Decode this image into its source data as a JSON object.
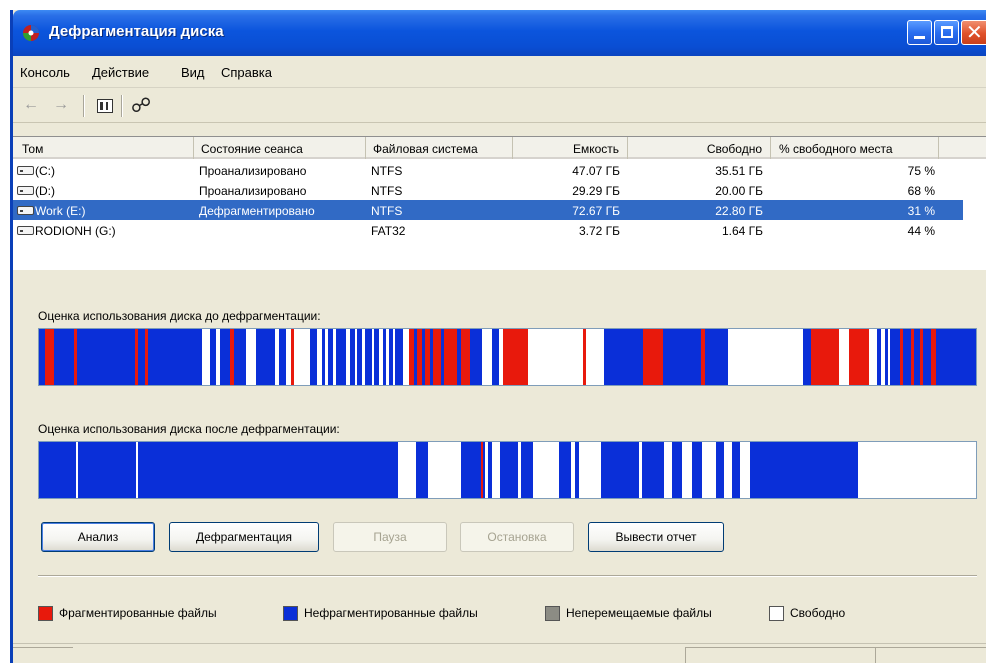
{
  "window": {
    "title": "Дефрагментация диска"
  },
  "menu": [
    "Консоль",
    "Действие",
    "Вид",
    "Справка"
  ],
  "toolbar": {
    "back_icon": "arrow-left-icon",
    "forward_icon": "arrow-right-icon",
    "view_icon": "show-hide-tree-icon",
    "help_icon": "help-icon"
  },
  "volumes": {
    "columns": [
      "Том",
      "Состояние сеанса",
      "Файловая система",
      "Емкость",
      "Свободно",
      "% свободного места"
    ],
    "rows": [
      {
        "name": "(C:)",
        "status": "Проанализировано",
        "fs": "NTFS",
        "capacity": "47.07 ГБ",
        "free": "35.51 ГБ",
        "pct": "75 %",
        "selected": false
      },
      {
        "name": "(D:)",
        "status": "Проанализировано",
        "fs": "NTFS",
        "capacity": "29.29 ГБ",
        "free": "20.00 ГБ",
        "pct": "68 %",
        "selected": false
      },
      {
        "name": "Work (E:)",
        "status": "Дефрагментировано",
        "fs": "NTFS",
        "capacity": "72.67 ГБ",
        "free": "22.80 ГБ",
        "pct": "31 %",
        "selected": true
      },
      {
        "name": "RODIONH (G:)",
        "status": "",
        "fs": "FAT32",
        "capacity": "3.72 ГБ",
        "free": "1.64 ГБ",
        "pct": "44 %",
        "selected": false
      }
    ]
  },
  "analysis": {
    "before_label": "Оценка использования диска до дефрагментации:",
    "after_label": "Оценка использования диска после дефрагментации:"
  },
  "buttons": {
    "analyze": "Анализ",
    "defragment": "Дефрагментация",
    "pause": "Пауза",
    "stop": "Остановка",
    "report": "Вывести отчет"
  },
  "legend": [
    {
      "label": "Фрагментированные файлы",
      "color": "#e8190c"
    },
    {
      "label": "Нефрагментированные файлы",
      "color": "#0a2fd8"
    },
    {
      "label": "Неперемещаемые файлы",
      "color": "#8c8c84"
    },
    {
      "label": "Свободно",
      "color": "#ffffff"
    }
  ],
  "colors": {
    "fragmented": "#e8190c",
    "contiguous": "#0a2fd8",
    "free": "#ffffff",
    "selection": "#316ac5"
  }
}
